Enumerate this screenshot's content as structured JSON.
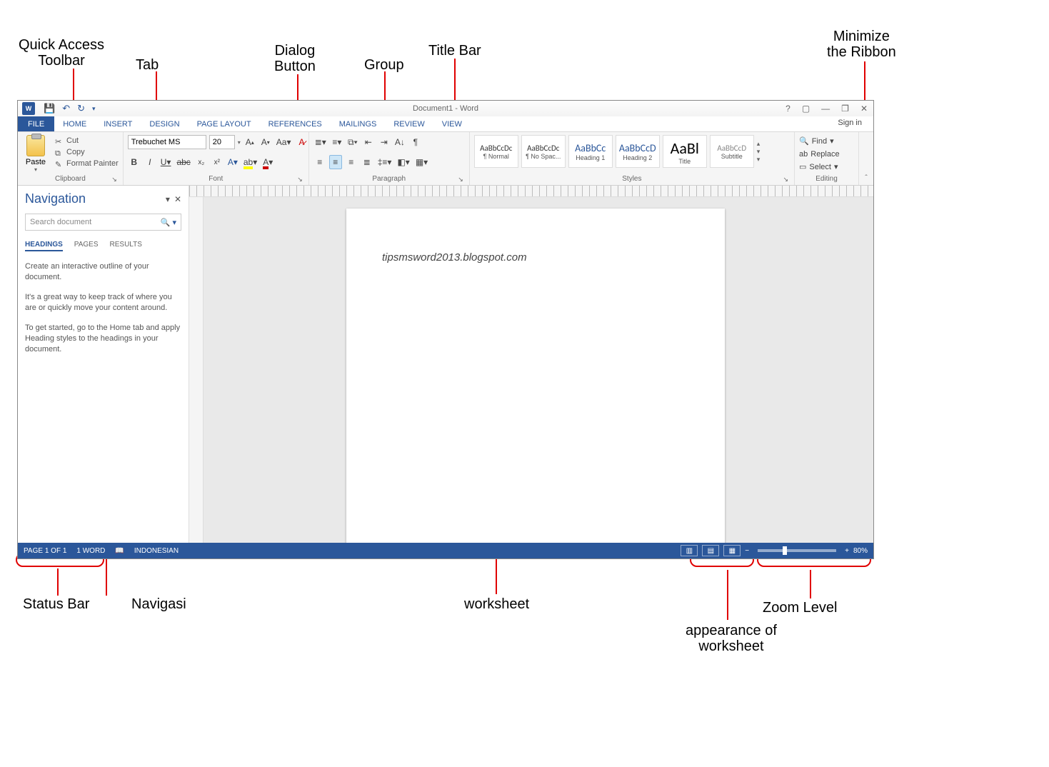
{
  "annotations": {
    "qat": "Quick Access\nToolbar",
    "tab": "Tab",
    "dialog": "Dialog\nButton",
    "group": "Group",
    "titlebar": "Title Bar",
    "minribbon": "Minimize\nthe Ribbon",
    "statusbar": "Status Bar",
    "navigasi": "Navigasi",
    "worksheet": "worksheet",
    "appearance": "appearance of\nworksheet",
    "zoom": "Zoom Level"
  },
  "titlebar": {
    "title": "Document1 - Word"
  },
  "tabs": {
    "file": "FILE",
    "list": [
      "HOME",
      "INSERT",
      "DESIGN",
      "PAGE LAYOUT",
      "REFERENCES",
      "MAILINGS",
      "REVIEW",
      "VIEW"
    ],
    "signin": "Sign in"
  },
  "clipboard": {
    "paste": "Paste",
    "cut": "Cut",
    "copy": "Copy",
    "format_painter": "Format Painter",
    "group_label": "Clipboard"
  },
  "font": {
    "name": "Trebuchet MS",
    "size": "20",
    "group_label": "Font"
  },
  "paragraph": {
    "group_label": "Paragraph"
  },
  "styles": {
    "items": [
      {
        "preview": "AaBbCcDc",
        "label": "¶ Normal"
      },
      {
        "preview": "AaBbCcDc",
        "label": "¶ No Spac..."
      },
      {
        "preview": "AaBbCc",
        "label": "Heading 1"
      },
      {
        "preview": "AaBbCcD",
        "label": "Heading 2"
      },
      {
        "preview": "AaBl",
        "label": "Title"
      },
      {
        "preview": "AaBbCcD",
        "label": "Subtitle"
      }
    ],
    "group_label": "Styles"
  },
  "editing": {
    "find": "Find",
    "replace": "Replace",
    "select": "Select",
    "group_label": "Editing"
  },
  "navpane": {
    "title": "Navigation",
    "search_placeholder": "Search document",
    "tabs": [
      "HEADINGS",
      "PAGES",
      "RESULTS"
    ],
    "para1": "Create an interactive outline of your document.",
    "para2": "It's a great way to keep track of where you are or quickly move your content around.",
    "para3": "To get started, go to the Home tab and apply Heading styles to the headings in your document."
  },
  "document": {
    "text": "tipsmsword2013.blogspot.com"
  },
  "status": {
    "page": "PAGE 1 OF 1",
    "words": "1 WORD",
    "language": "INDONESIAN",
    "zoom": "80%"
  }
}
